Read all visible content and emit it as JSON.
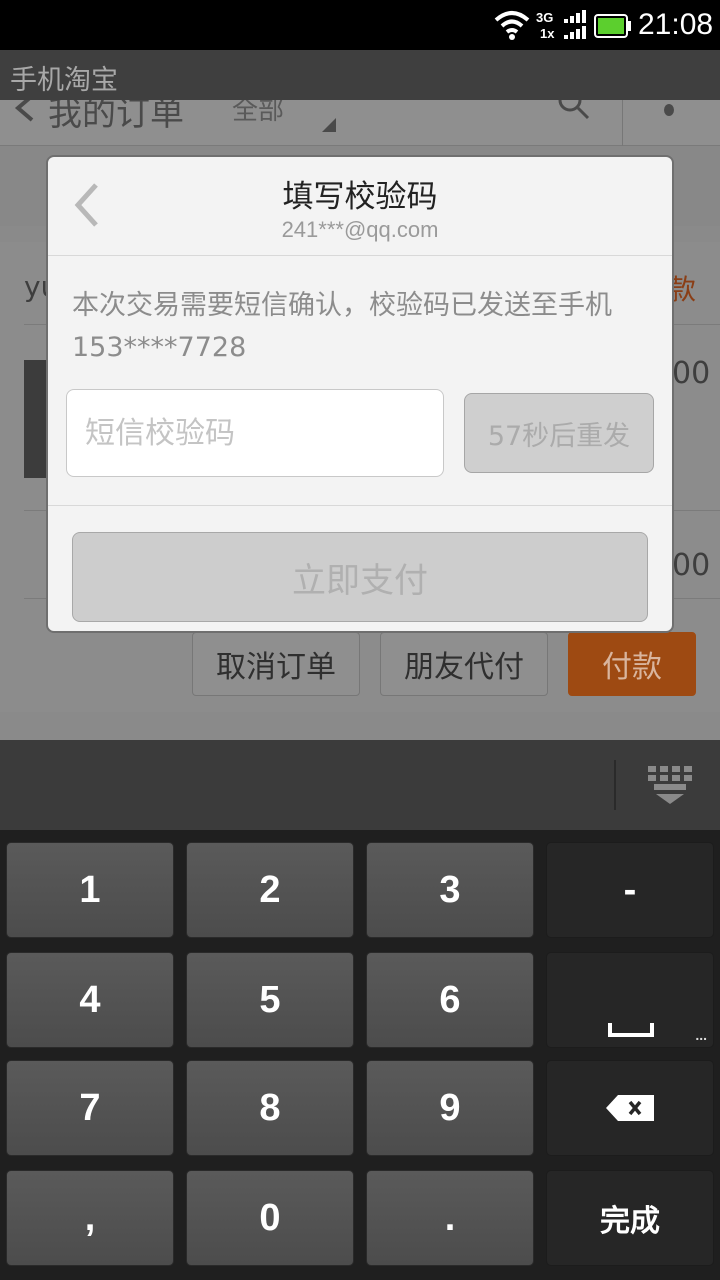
{
  "status_bar": {
    "time": "21:08",
    "network_top": "3G",
    "network_bottom": "1x",
    "wifi_icon": "wifi-icon",
    "battery_icon": "battery-icon"
  },
  "app": {
    "title": "手机淘宝"
  },
  "background": {
    "nav_title": "我的订单",
    "nav_filter": "全部",
    "order_shop_partial": "yu",
    "order_status_partial": "款",
    "price_partial_1": "00",
    "price_partial_2": "00",
    "actions": {
      "cancel_label": "取消订单",
      "friend_pay_label": "朋友代付",
      "pay_label": "付款"
    }
  },
  "dialog": {
    "title": "填写校验码",
    "subtitle": "241***@qq.com",
    "message": "本次交易需要短信确认，校验码已发送至手机153****7728",
    "code_input_value": "",
    "code_input_placeholder": "短信校验码",
    "resend_label": "57秒后重发",
    "pay_now_label": "立即支付"
  },
  "keyboard": {
    "keys": {
      "k1": "1",
      "k2": "2",
      "k3": "3",
      "minus": "-",
      "k4": "4",
      "k5": "5",
      "k6": "6",
      "k7": "7",
      "k8": "8",
      "k9": "9",
      "comma": ",",
      "k0": "0",
      "dot": ".",
      "more": "...",
      "done": "完成"
    }
  },
  "colors": {
    "accent_orange": "#ff6600",
    "status_bar_bg": "#000000",
    "battery_green": "#5ccf2e"
  }
}
